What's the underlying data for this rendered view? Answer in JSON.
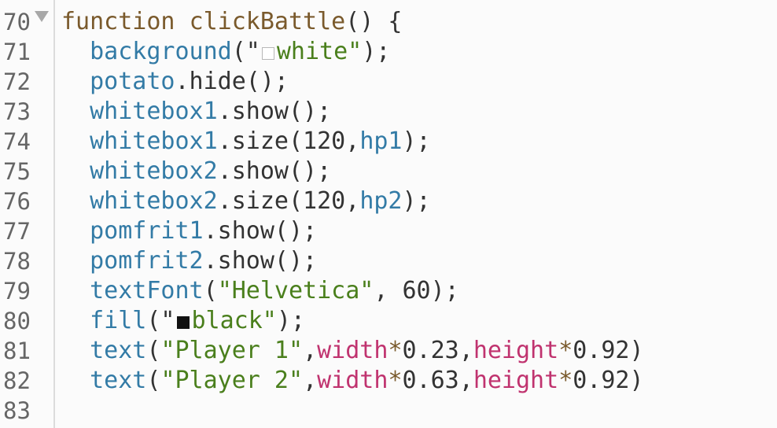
{
  "editor": {
    "partial_top_line": "69",
    "lines": [
      {
        "number": "70",
        "tokens": [
          {
            "t": "function",
            "c": "kw"
          },
          {
            "t": " ",
            "c": "plain"
          },
          {
            "t": "clickBattle",
            "c": "kw"
          },
          {
            "t": "() {",
            "c": "plain"
          }
        ]
      },
      {
        "number": "71",
        "tokens": [
          {
            "t": "  ",
            "c": "plain"
          },
          {
            "t": "background",
            "c": "fn"
          },
          {
            "t": "(\"",
            "c": "plain"
          },
          {
            "sw": "white"
          },
          {
            "t": "white\"",
            "c": "str"
          },
          {
            "t": ");",
            "c": "plain"
          }
        ]
      },
      {
        "number": "72",
        "tokens": [
          {
            "t": "  ",
            "c": "plain"
          },
          {
            "t": "potato",
            "c": "fn"
          },
          {
            "t": ".hide();",
            "c": "plain"
          }
        ]
      },
      {
        "number": "73",
        "tokens": [
          {
            "t": "  ",
            "c": "plain"
          },
          {
            "t": "whitebox1",
            "c": "fn"
          },
          {
            "t": ".show();",
            "c": "plain"
          }
        ]
      },
      {
        "number": "74",
        "tokens": [
          {
            "t": "  ",
            "c": "plain"
          },
          {
            "t": "whitebox1",
            "c": "fn"
          },
          {
            "t": ".size(120,",
            "c": "plain"
          },
          {
            "t": "hp1",
            "c": "fn"
          },
          {
            "t": ");",
            "c": "plain"
          }
        ]
      },
      {
        "number": "75",
        "tokens": [
          {
            "t": "  ",
            "c": "plain"
          },
          {
            "t": "whitebox2",
            "c": "fn"
          },
          {
            "t": ".show();",
            "c": "plain"
          }
        ]
      },
      {
        "number": "76",
        "tokens": [
          {
            "t": "  ",
            "c": "plain"
          },
          {
            "t": "whitebox2",
            "c": "fn"
          },
          {
            "t": ".size(120,",
            "c": "plain"
          },
          {
            "t": "hp2",
            "c": "fn"
          },
          {
            "t": ");",
            "c": "plain"
          }
        ]
      },
      {
        "number": "77",
        "tokens": [
          {
            "t": "  ",
            "c": "plain"
          },
          {
            "t": "pomfrit1",
            "c": "fn"
          },
          {
            "t": ".show();",
            "c": "plain"
          }
        ]
      },
      {
        "number": "78",
        "tokens": [
          {
            "t": "  ",
            "c": "plain"
          },
          {
            "t": "pomfrit2",
            "c": "fn"
          },
          {
            "t": ".show();",
            "c": "plain"
          }
        ]
      },
      {
        "number": "79",
        "tokens": [
          {
            "t": "  ",
            "c": "plain"
          },
          {
            "t": "textFont",
            "c": "fn"
          },
          {
            "t": "(",
            "c": "plain"
          },
          {
            "t": "\"Helvetica\"",
            "c": "str"
          },
          {
            "t": ", 60);",
            "c": "plain"
          }
        ]
      },
      {
        "number": "80",
        "tokens": [
          {
            "t": "  ",
            "c": "plain"
          },
          {
            "t": "fill",
            "c": "fn"
          },
          {
            "t": "(\"",
            "c": "plain"
          },
          {
            "sw": "black"
          },
          {
            "t": "black\"",
            "c": "str"
          },
          {
            "t": ");",
            "c": "plain"
          }
        ]
      },
      {
        "number": "81",
        "tokens": [
          {
            "t": "  ",
            "c": "plain"
          },
          {
            "t": "text",
            "c": "fn"
          },
          {
            "t": "(",
            "c": "plain"
          },
          {
            "t": "\"Player 1\"",
            "c": "str"
          },
          {
            "t": ",",
            "c": "plain"
          },
          {
            "t": "width",
            "c": "var"
          },
          {
            "t": "*",
            "c": "kw"
          },
          {
            "t": "0.23,",
            "c": "plain"
          },
          {
            "t": "height",
            "c": "var"
          },
          {
            "t": "*",
            "c": "kw"
          },
          {
            "t": "0.92)",
            "c": "plain"
          }
        ]
      },
      {
        "number": "82",
        "tokens": [
          {
            "t": "  ",
            "c": "plain"
          },
          {
            "t": "text",
            "c": "fn"
          },
          {
            "t": "(",
            "c": "plain"
          },
          {
            "t": "\"Player 2\"",
            "c": "str"
          },
          {
            "t": ",",
            "c": "plain"
          },
          {
            "t": "width",
            "c": "var"
          },
          {
            "t": "*",
            "c": "kw"
          },
          {
            "t": "0.63,",
            "c": "plain"
          },
          {
            "t": "height",
            "c": "var"
          },
          {
            "t": "*",
            "c": "kw"
          },
          {
            "t": "0.92)",
            "c": "plain"
          }
        ]
      },
      {
        "number": "83",
        "tokens": []
      }
    ],
    "colors": {
      "keyword": "#7a5a2c",
      "function": "#337ba6",
      "string": "#4a7f1c",
      "variable": "#c0336f",
      "plain": "#333333",
      "gutter_text": "#666666",
      "background": "#fbfbfb"
    },
    "icons": {
      "fold": "fold-triangle-icon",
      "white_swatch": "color-swatch-white-icon",
      "black_swatch": "color-swatch-black-icon"
    }
  }
}
